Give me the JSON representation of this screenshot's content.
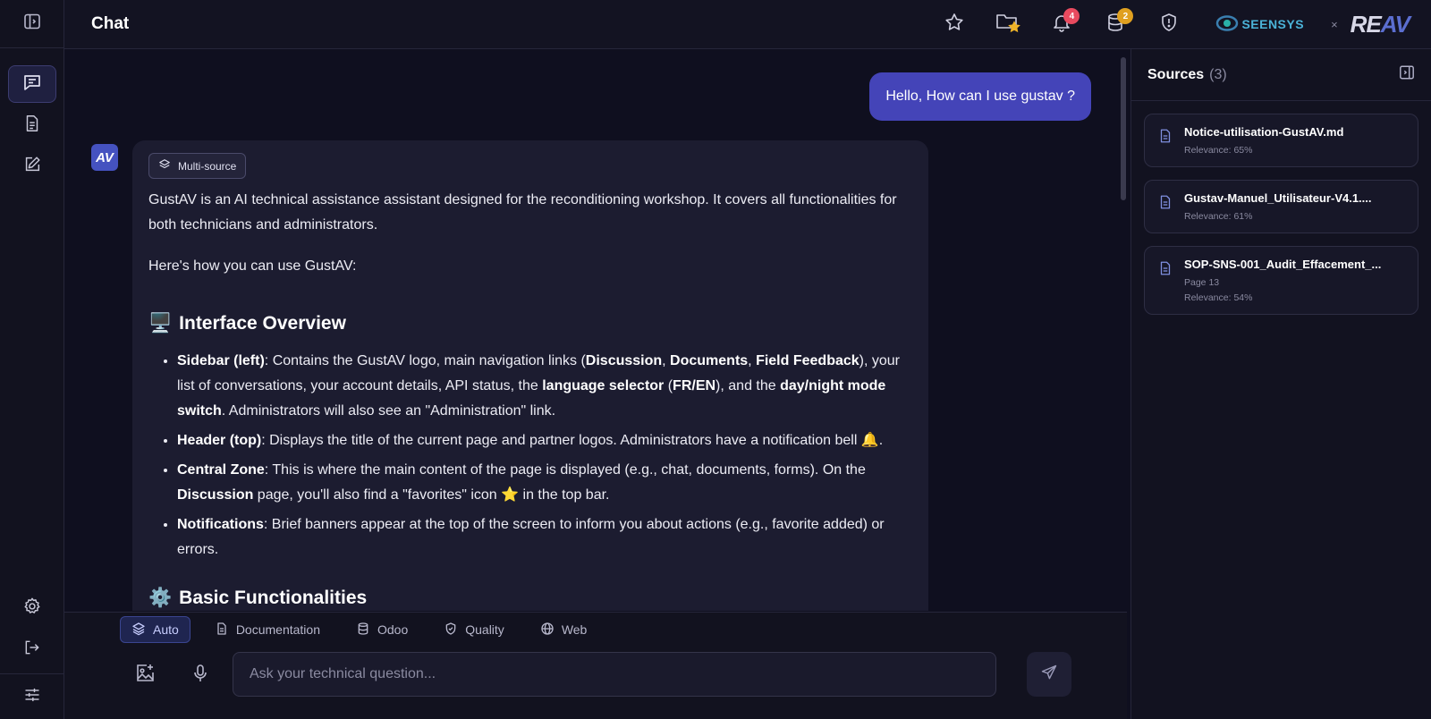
{
  "header": {
    "title": "Chat",
    "notification_count": "4",
    "database_count": "2",
    "partner_logo_1": "SEENSYS",
    "partner_separator": "×",
    "partner_logo_2_prefix": "RE",
    "partner_logo_2_suffix": "AV"
  },
  "rail": {
    "items": [
      "chat",
      "documents",
      "edit"
    ],
    "bottom": [
      "settings",
      "logout",
      "filters"
    ]
  },
  "chat": {
    "user_message": "Hello, How can I use gustav ?",
    "avatar_label": "AV",
    "chip_label": "Multi-source",
    "intro": "GustAV is an AI technical assistance assistant designed for the reconditioning workshop. It covers all functionalities for both technicians and administrators.",
    "howto": "Here's how you can use GustAV:",
    "section1_emoji": "🖥️",
    "section1_title": "Interface Overview",
    "items": [
      {
        "bold": "Sidebar (left)",
        "t1": ": Contains the GustAV logo, main navigation links (",
        "b2": "Discussion",
        "t2": ", ",
        "b3": "Documents",
        "t3": ", ",
        "b4": "Field Feedback",
        "t4": "), your list of conversations, your account details, API status, the ",
        "b5": "language selector",
        "t5": " (",
        "b6": "FR/EN",
        "t6": "), and the ",
        "b7": "day/night mode switch",
        "t7": ". Administrators will also see an \"Administration\" link."
      },
      {
        "bold": "Header (top)",
        "t1": ": Displays the title of the current page and partner logos. Administrators have a notification bell 🔔."
      },
      {
        "bold": "Central Zone",
        "t1": ": This is where the main content of the page is displayed (e.g., chat, documents, forms). On the ",
        "b2": "Discussion",
        "t2": " page, you'll also find a \"favorites\" icon ⭐ in the top bar."
      },
      {
        "bold": "Notifications",
        "t1": ": Brief banners appear at the top of the screen to inform you about actions (e.g., favorite added) or errors."
      }
    ],
    "section2_emoji": "⚙️",
    "section2_title": "Basic Functionalities"
  },
  "composer": {
    "modes": [
      "Auto",
      "Documentation",
      "Odoo",
      "Quality",
      "Web"
    ],
    "active_mode": "Auto",
    "placeholder": "Ask your technical question..."
  },
  "sources": {
    "title": "Sources",
    "count": "(3)",
    "items": [
      {
        "name": "Notice-utilisation-GustAV.md",
        "page": "",
        "relevance": "Relevance: 65%"
      },
      {
        "name": "Gustav-Manuel_Utilisateur-V4.1....",
        "page": "",
        "relevance": "Relevance: 61%"
      },
      {
        "name": "SOP-SNS-001_Audit_Effacement_...",
        "page": "Page 13",
        "relevance": "Relevance: 54%"
      }
    ]
  },
  "colors": {
    "accent": "#4444b8",
    "background": "#0f0f1f",
    "badge_red": "#e84a5f",
    "badge_amber": "#e0a020"
  }
}
